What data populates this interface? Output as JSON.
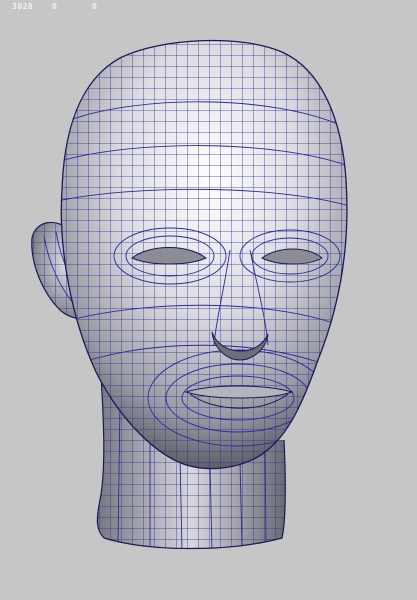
{
  "viewport": {
    "name": "3d-viewport",
    "background": "#c6c6c6",
    "wire_color": "#2a2aa0",
    "outline_color": "#1a1a5a"
  },
  "heads_up": {
    "poly_count": "3028",
    "value_2": "0",
    "value_3": "0"
  },
  "model": {
    "type": "head-mesh",
    "display": "wireframe-on-shaded"
  }
}
